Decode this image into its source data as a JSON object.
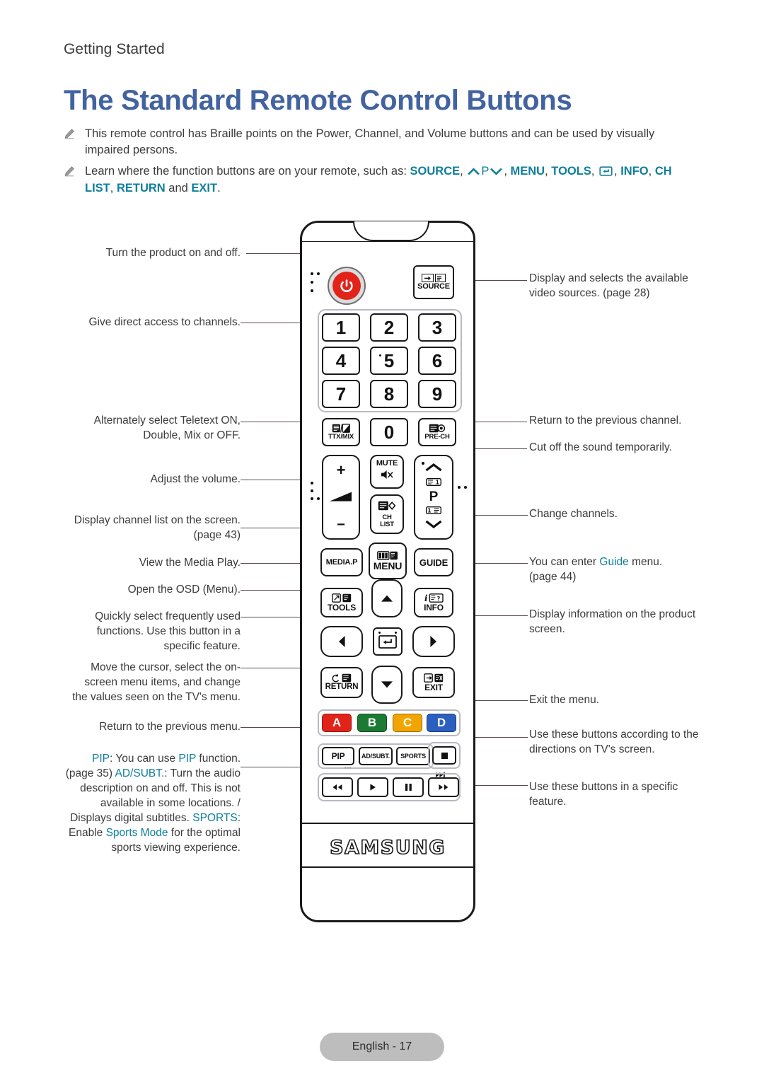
{
  "breadcrumb": "Getting Started",
  "title": "The Standard Remote Control Buttons",
  "colors": {
    "title_blue": "#42639f",
    "accent_teal": "#0d7e9c",
    "power_red": "#e2231a",
    "btn_a_red": "#e2231a",
    "btn_b_green": "#1d7a34",
    "btn_c_amber": "#f0a500",
    "btn_d_blue": "#2b5fc0",
    "footer_grey": "#bdbdbd"
  },
  "notes": [
    {
      "icon": "pencil-icon",
      "text": "This remote control has Braille points on the Power, Channel, and Volume buttons and can be used by visually impaired persons."
    },
    {
      "icon": "pencil-icon",
      "lead": "Learn where the function buttons are on your remote, such as:",
      "terms": [
        "SOURCE",
        "P",
        "MENU",
        "TOOLS",
        "INFO",
        "CH LIST",
        "RETURN",
        "EXIT"
      ],
      "conjunction": "and",
      "terminator": "."
    }
  ],
  "callouts_left": [
    {
      "id": "power",
      "text": "Turn the product on and off."
    },
    {
      "id": "numbers",
      "text": "Give direct access to channels."
    },
    {
      "id": "ttxmix",
      "text": "Alternately select Teletext ON, Double, Mix or OFF."
    },
    {
      "id": "volume",
      "text": "Adjust the volume."
    },
    {
      "id": "chlist",
      "text": "Display channel list on the screen. (page 43)"
    },
    {
      "id": "mediap",
      "text": "View the Media Play."
    },
    {
      "id": "menu",
      "text": "Open the OSD (Menu)."
    },
    {
      "id": "tools",
      "text": "Quickly select frequently used functions. Use this button in a specific feature."
    },
    {
      "id": "dpad",
      "text": "Move the cursor, select the on-screen menu items, and change the values seen on the TV's menu."
    },
    {
      "id": "return",
      "text": "Return to the previous menu."
    }
  ],
  "callout_left_multi": {
    "pip_label": "PIP",
    "pip_text_1": ": You can use ",
    "pip_term": "PIP",
    "pip_text_2": " function. (page 35)",
    "adsubt_label": "AD/SUBT.",
    "adsubt_text": ": Turn the audio description on and off. This is not available in some locations. / Displays digital subtitles.",
    "sports_label": "SPORTS",
    "sports_text_1": ": Enable ",
    "sports_term": "Sports Mode",
    "sports_text_2": " for the optimal sports viewing experience."
  },
  "callouts_right": [
    {
      "id": "source",
      "text": "Display and selects the available video sources. (page 28)"
    },
    {
      "id": "prech",
      "text": "Return to the previous channel."
    },
    {
      "id": "mute",
      "text": "Cut off the sound temporarily."
    },
    {
      "id": "chupdn",
      "text": "Change channels."
    },
    {
      "id": "guide",
      "pre": "You can enter ",
      "term": "Guide",
      "post": " menu. (page 44)"
    },
    {
      "id": "info",
      "text": "Display information on the product screen."
    },
    {
      "id": "exit",
      "text": "Exit the menu."
    },
    {
      "id": "abcd",
      "text": "Use these buttons according to the directions on TV's screen."
    },
    {
      "id": "media",
      "text": "Use these buttons in a specific feature."
    }
  ],
  "remote": {
    "brand": "SAMSUNG",
    "power_icon": "power-icon",
    "source_label": "SOURCE",
    "numbers": [
      "1",
      "2",
      "3",
      "4",
      "5",
      "6",
      "7",
      "8",
      "9",
      "0"
    ],
    "ttxmix_label": "TTX/MIX",
    "prech_label": "PRE-CH",
    "mute_label": "MUTE",
    "chlist_label": "CH LIST",
    "chlist_line1": "CH",
    "chlist_line2": "LIST",
    "volume_up": "+",
    "volume_down": "−",
    "channel_label": "P",
    "mediap_label": "MEDIA.P",
    "menu_label": "MENU",
    "guide_label": "GUIDE",
    "tools_label": "TOOLS",
    "info_label": "INFO",
    "return_label": "RETURN",
    "exit_label": "EXIT",
    "color_buttons": [
      {
        "label": "A",
        "color": "#e2231a"
      },
      {
        "label": "B",
        "color": "#1d7a34"
      },
      {
        "label": "C",
        "color": "#f0a500"
      },
      {
        "label": "D",
        "color": "#2b5fc0"
      }
    ],
    "fn_buttons": [
      "PIP",
      "AD/SUBT.",
      "SPORTS"
    ],
    "media_buttons": [
      "stop-icon",
      "rewind-icon",
      "play-icon",
      "pause-icon",
      "fast-forward-icon"
    ]
  },
  "footer": {
    "label": "English - 17"
  }
}
